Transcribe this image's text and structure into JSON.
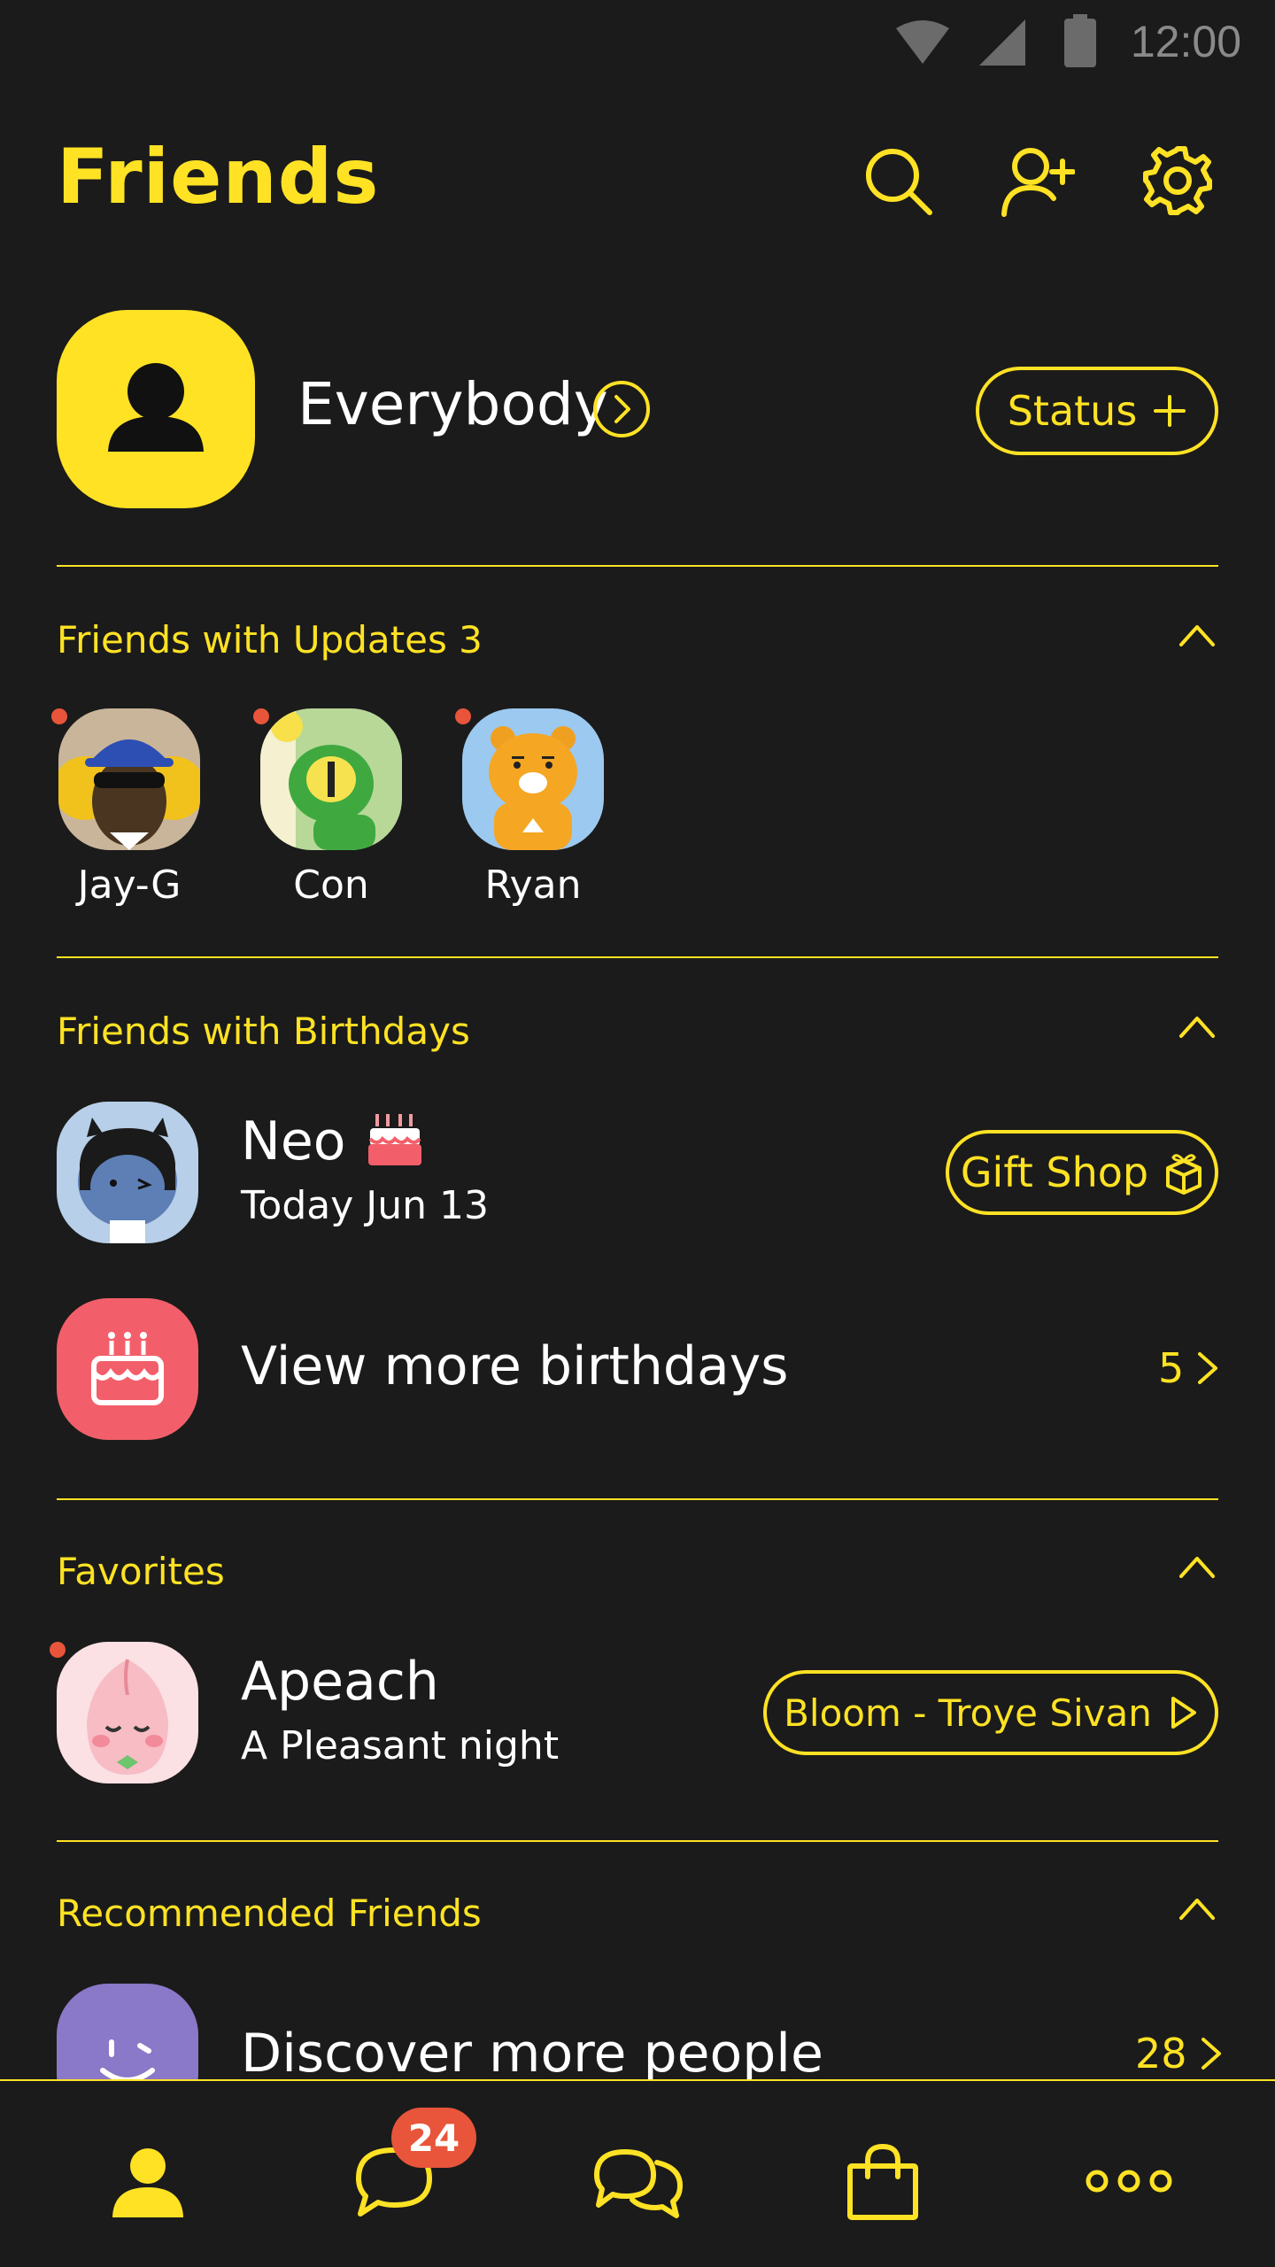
{
  "status_bar": {
    "time": "12:00"
  },
  "header": {
    "title": "Friends",
    "icons": [
      "search-icon",
      "add-friend-icon",
      "settings-icon"
    ]
  },
  "profile": {
    "name": "Everybody",
    "status_button": "Status",
    "status_button_icon": "plus-icon"
  },
  "updates": {
    "title": "Friends with Updates 3",
    "friends": [
      {
        "name": "Jay-G"
      },
      {
        "name": "Con"
      },
      {
        "name": "Ryan"
      }
    ]
  },
  "birthdays": {
    "title": "Friends with Birthdays",
    "friend": {
      "name": "Neo",
      "date": "Today Jun 13",
      "gift_button": "Gift Shop"
    },
    "view_more": {
      "label": "View more birthdays",
      "count": "5"
    }
  },
  "favorites": {
    "title": "Favorites",
    "friend": {
      "name": "Apeach",
      "status": "A Pleasant night",
      "music_button": "Bloom - Troye Sivan"
    }
  },
  "recommended": {
    "title": "Recommended Friends",
    "discover": {
      "label": "Discover more people",
      "count": "28"
    }
  },
  "bottom_nav": {
    "chat_badge": "24",
    "items": [
      "friends-tab-icon",
      "chats-tab-icon",
      "openchat-tab-icon",
      "shopping-tab-icon",
      "more-tab-icon"
    ]
  },
  "colors": {
    "background": "#1b1b1b",
    "accent": "#ffe224",
    "badge": "#e8553b",
    "birthday_tile": "#f25f6a",
    "discover_tile": "#8a78c8"
  }
}
